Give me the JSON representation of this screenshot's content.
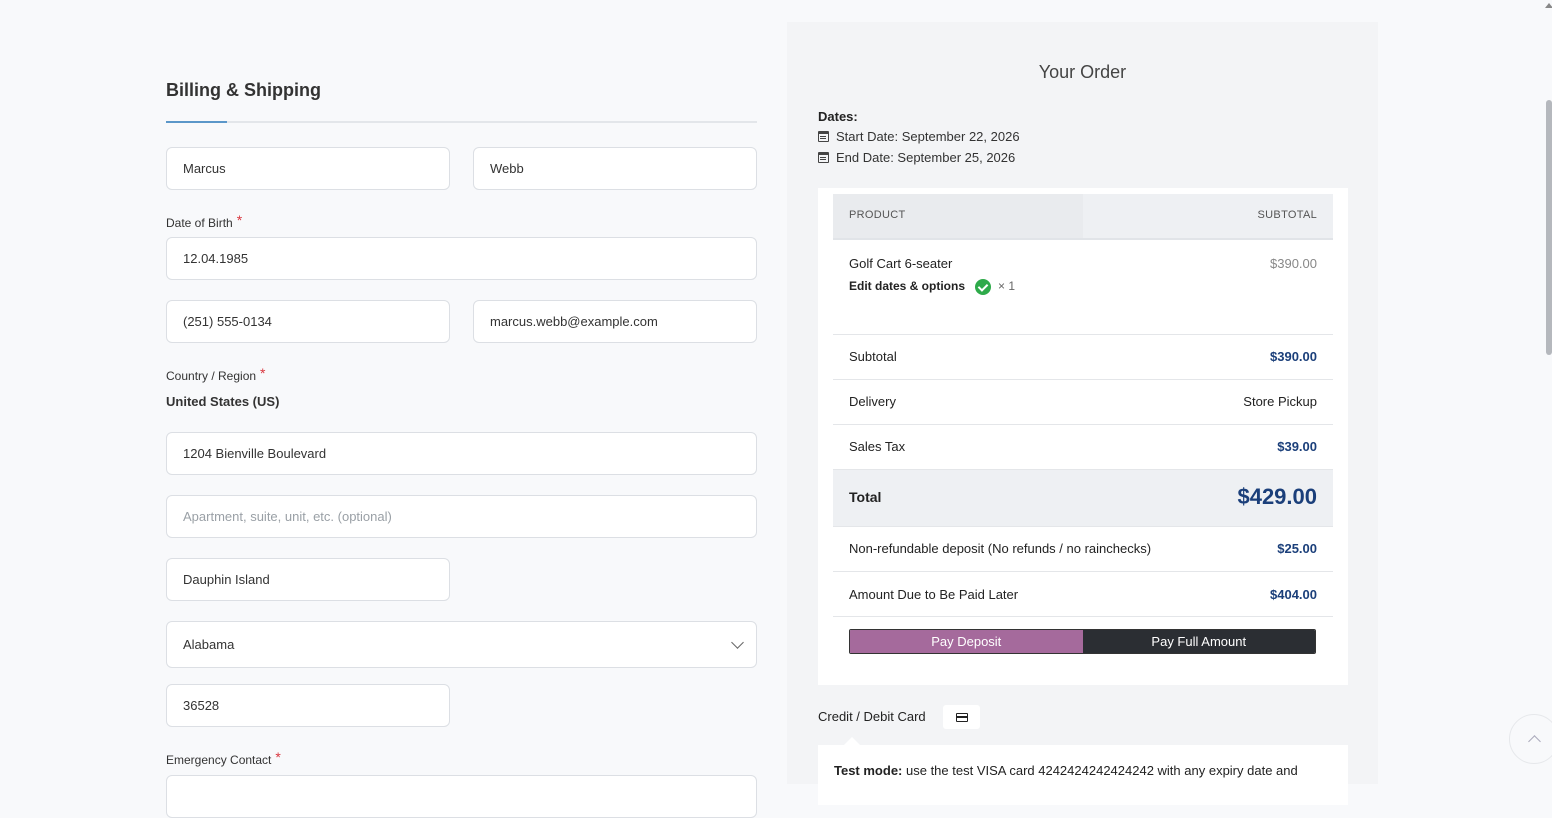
{
  "billing": {
    "title": "Billing & Shipping",
    "first_name": "Marcus",
    "last_name": "Webb",
    "dob_label": "Date of Birth",
    "dob": "12.04.1985",
    "phone": "(251) 555-0134",
    "email": "marcus.webb@example.com",
    "country_label": "Country / Region",
    "country": "United States (US)",
    "address1": "1204 Bienville Boulevard",
    "address2_placeholder": "Apartment, suite, unit, etc. (optional)",
    "city": "Dauphin Island",
    "state": "Alabama",
    "zip": "36528",
    "emergency_label": "Emergency Contact",
    "required_mark": "*"
  },
  "order": {
    "title": "Your Order",
    "dates_label": "Dates:",
    "start_date": "Start Date: September 22, 2026",
    "end_date": "End Date: September 25, 2026",
    "head_product": "PRODUCT",
    "head_subtotal": "SUBTOTAL",
    "product_name": "Golf Cart 6-seater",
    "product_price": "$390.00",
    "edit_link": "Edit dates & options",
    "quantity": "× 1",
    "subtotal_label": "Subtotal",
    "subtotal_value": "$390.00",
    "delivery_label": "Delivery",
    "delivery_value": "Store Pickup",
    "tax_label": "Sales Tax",
    "tax_value": "$39.00",
    "total_label": "Total",
    "total_value": "$429.00",
    "deposit_label": "Non-refundable deposit (No refunds / no rainchecks)",
    "deposit_value": "$25.00",
    "due_label": "Amount Due to Be Paid Later",
    "due_value": "$404.00",
    "pay_deposit": "Pay Deposit",
    "pay_full": "Pay Full Amount"
  },
  "payment": {
    "method_label": "Credit / Debit Card",
    "card_icon": "credit-card-icon",
    "test_mode_strong": "Test mode:",
    "test_mode_text": " use the test VISA card 4242424242424242 with any expiry date and"
  },
  "colors": {
    "accent": "#5b97c9",
    "price_blue": "#1b3f7a",
    "deposit_purple": "#a56a9c",
    "dark": "#2b2e33",
    "check_green": "#2eaa4a"
  }
}
